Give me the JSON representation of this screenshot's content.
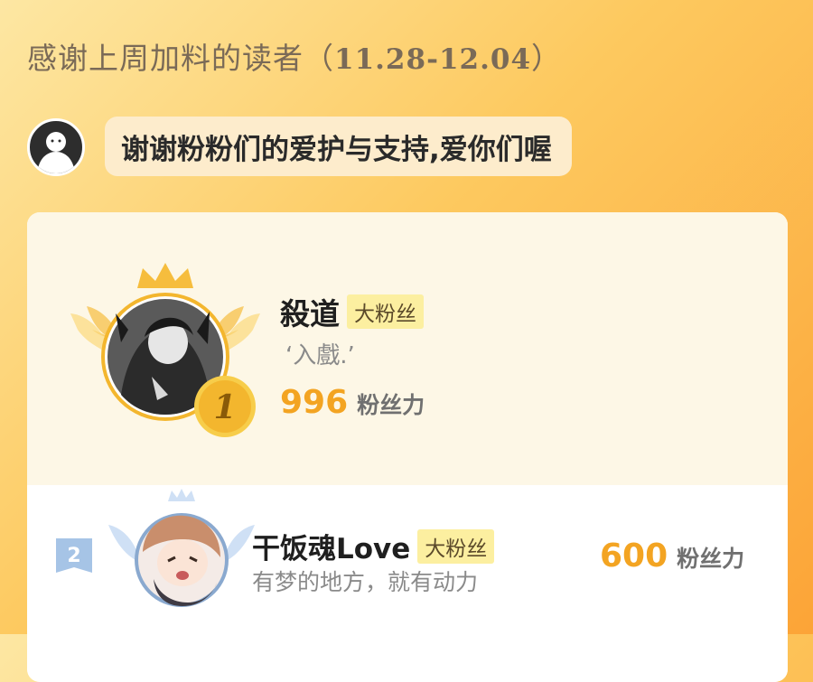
{
  "header": {
    "title": "感谢上周加料的读者（",
    "date_range": "11.28-12.04",
    "title_end": "）"
  },
  "owner_message": "谢谢粉粉们的爱护与支持,爱你们喔",
  "colors": {
    "accent": "#f3a422",
    "badge_bg": "#fcefa0",
    "bubble_bg": "#fdeccc"
  },
  "ranking": [
    {
      "rank": "1",
      "name": "殺道",
      "tag": "大粉丝",
      "motto": "‘入戲.’",
      "score": "996",
      "score_unit": "粉丝力"
    },
    {
      "rank": "2",
      "name": "干饭魂Love",
      "tag": "大粉丝",
      "motto": "有梦的地方，就有动力",
      "score": "600",
      "score_unit": "粉丝力"
    }
  ]
}
